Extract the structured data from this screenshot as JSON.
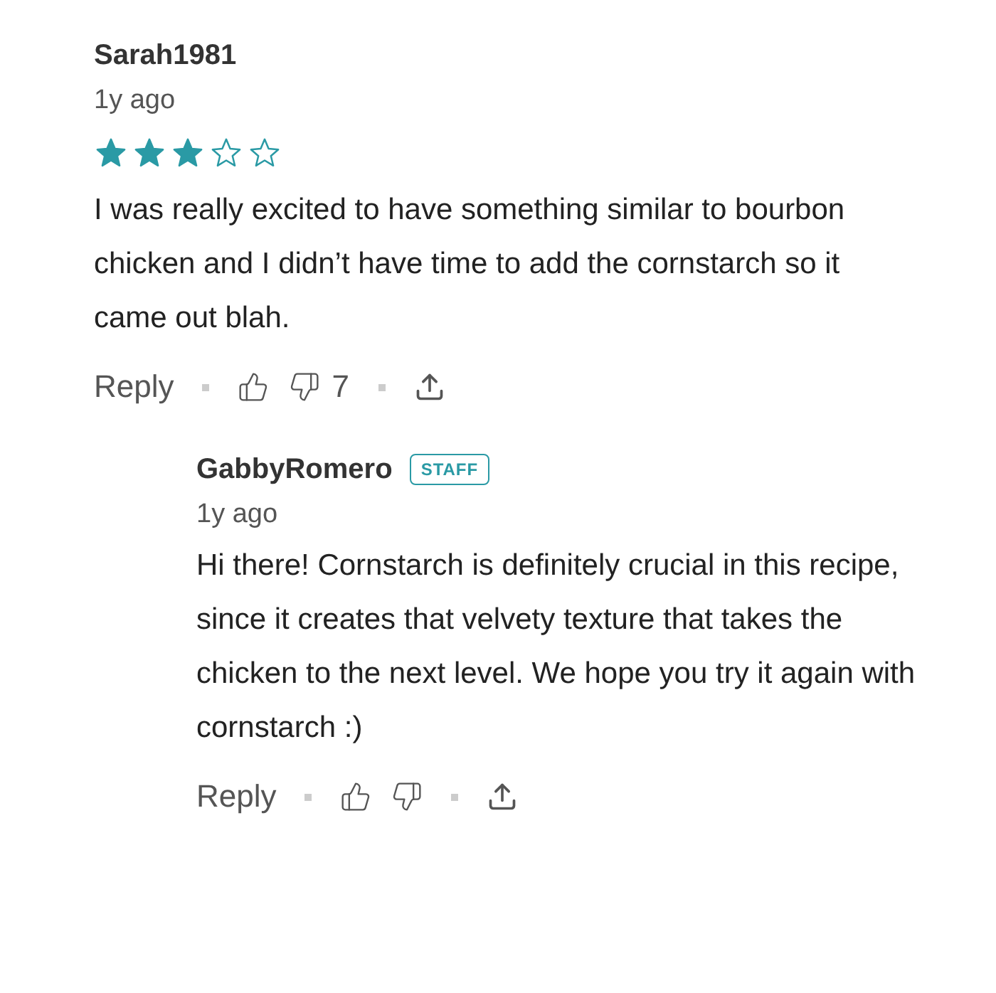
{
  "comments": [
    {
      "author": "Sarah1981",
      "time": "1y ago",
      "stars": 3,
      "body": "I was really excited to have something similar to bourbon chicken and I didn’t have time to add the cornstarch so it came out blah.",
      "reply_label": "Reply",
      "vote_count": "7",
      "replies": [
        {
          "author": "GabbyRomero",
          "badge": "STAFF",
          "time": "1y ago",
          "body": "Hi there! Cornstarch is definitely crucial in this recipe, since it creates that velvety texture that takes the chicken to the next level. We hope you try it again with cornstarch :)",
          "reply_label": "Reply"
        }
      ]
    }
  ]
}
